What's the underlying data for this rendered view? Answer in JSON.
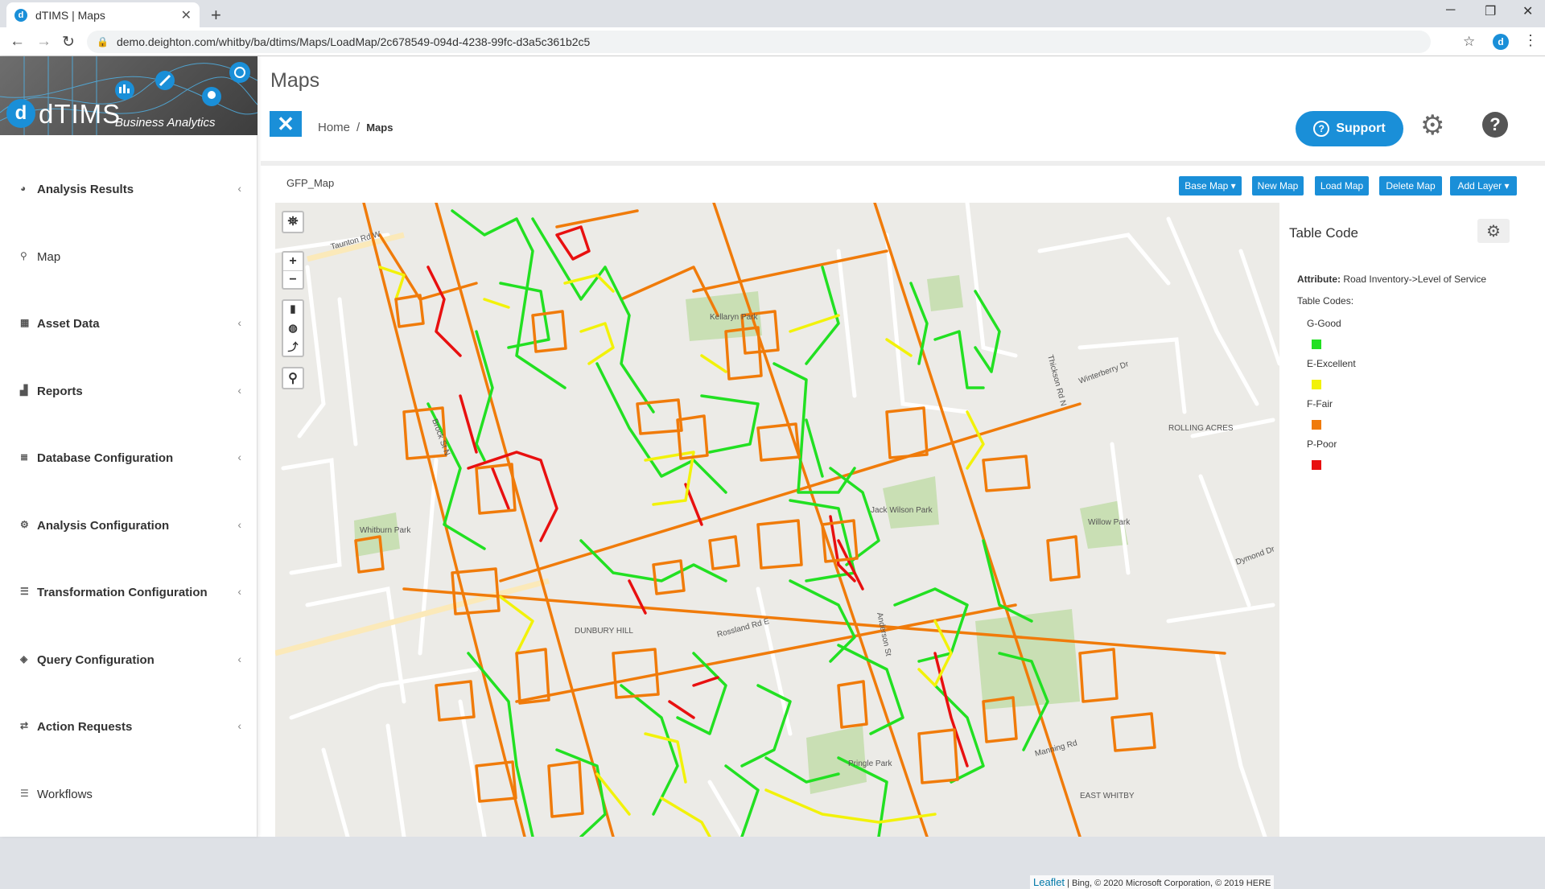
{
  "browser": {
    "tab_title": "dTIMS | Maps",
    "favicon": "d",
    "url": "demo.deighton.com/whitby/ba/dtims/Maps/LoadMap/2c678549-094d-4238-99fc-d3a5c361b2c5",
    "profile_initial": "d"
  },
  "logo": {
    "badge": "d",
    "brand": "dTIMS",
    "tagline": "Business Analytics"
  },
  "sidebar": {
    "items": [
      {
        "label": "Analysis Results",
        "icon": "dashboard-icon",
        "has_chevron": true
      },
      {
        "label": "Map",
        "icon": "map-marker-icon",
        "has_chevron": false
      },
      {
        "label": "Asset Data",
        "icon": "table-icon",
        "has_chevron": true
      },
      {
        "label": "Reports",
        "icon": "bar-chart-icon",
        "has_chevron": true
      },
      {
        "label": "Database Configuration",
        "icon": "database-icon",
        "has_chevron": true
      },
      {
        "label": "Analysis Configuration",
        "icon": "cogs-icon",
        "has_chevron": true
      },
      {
        "label": "Transformation Configuration",
        "icon": "list-icon",
        "has_chevron": true
      },
      {
        "label": "Query Configuration",
        "icon": "cube-icon",
        "has_chevron": true
      },
      {
        "label": "Action Requests",
        "icon": "retweet-icon",
        "has_chevron": true
      },
      {
        "label": "Workflows",
        "icon": "list-icon",
        "has_chevron": false
      }
    ]
  },
  "header": {
    "title": "Maps",
    "breadcrumb_home": "Home",
    "breadcrumb_sep": "/",
    "breadcrumb_current": "Maps",
    "support_label": "Support"
  },
  "map": {
    "name": "GFP_Map",
    "toolbar": {
      "base_map": "Base Map ▾",
      "new_map": "New Map",
      "load_map": "Load Map",
      "delete_map": "Delete Map",
      "add_layer": "Add Layer ▾"
    },
    "zoom_in": "+",
    "zoom_out": "−",
    "attribution_leaflet": "Leaflet",
    "attribution_rest": " | Bing, © 2020 Microsoft Corporation, © 2019 HERE",
    "place_labels": [
      "Kellaryn Park",
      "Jack Wilson Park",
      "Whitburn Park",
      "Willow Park",
      "DUNBURY HILL",
      "ROLLING ACRES",
      "Pringle Park",
      "EAST WHITBY",
      "Rossland Rd E",
      "Brock St N",
      "Anderson St",
      "Thickson Rd N",
      "Manning Rd",
      "Taunton Rd W",
      "Winterberry Dr",
      "Dymond Dr"
    ],
    "road_colors": {
      "good": "#22e022",
      "excellent": "#f2f20a",
      "fair": "#f07b0a",
      "poor": "#e81010"
    }
  },
  "legend": {
    "title": "Table Code",
    "attribute_label": "Attribute:",
    "attribute_value": " Road Inventory->Level of Service",
    "codes_label": "Table Codes:",
    "codes": [
      {
        "label": "G-Good",
        "color": "#22e022"
      },
      {
        "label": "E-Excellent",
        "color": "#f2f20a"
      },
      {
        "label": "F-Fair",
        "color": "#f07b0a"
      },
      {
        "label": "P-Poor",
        "color": "#e81010"
      }
    ]
  }
}
